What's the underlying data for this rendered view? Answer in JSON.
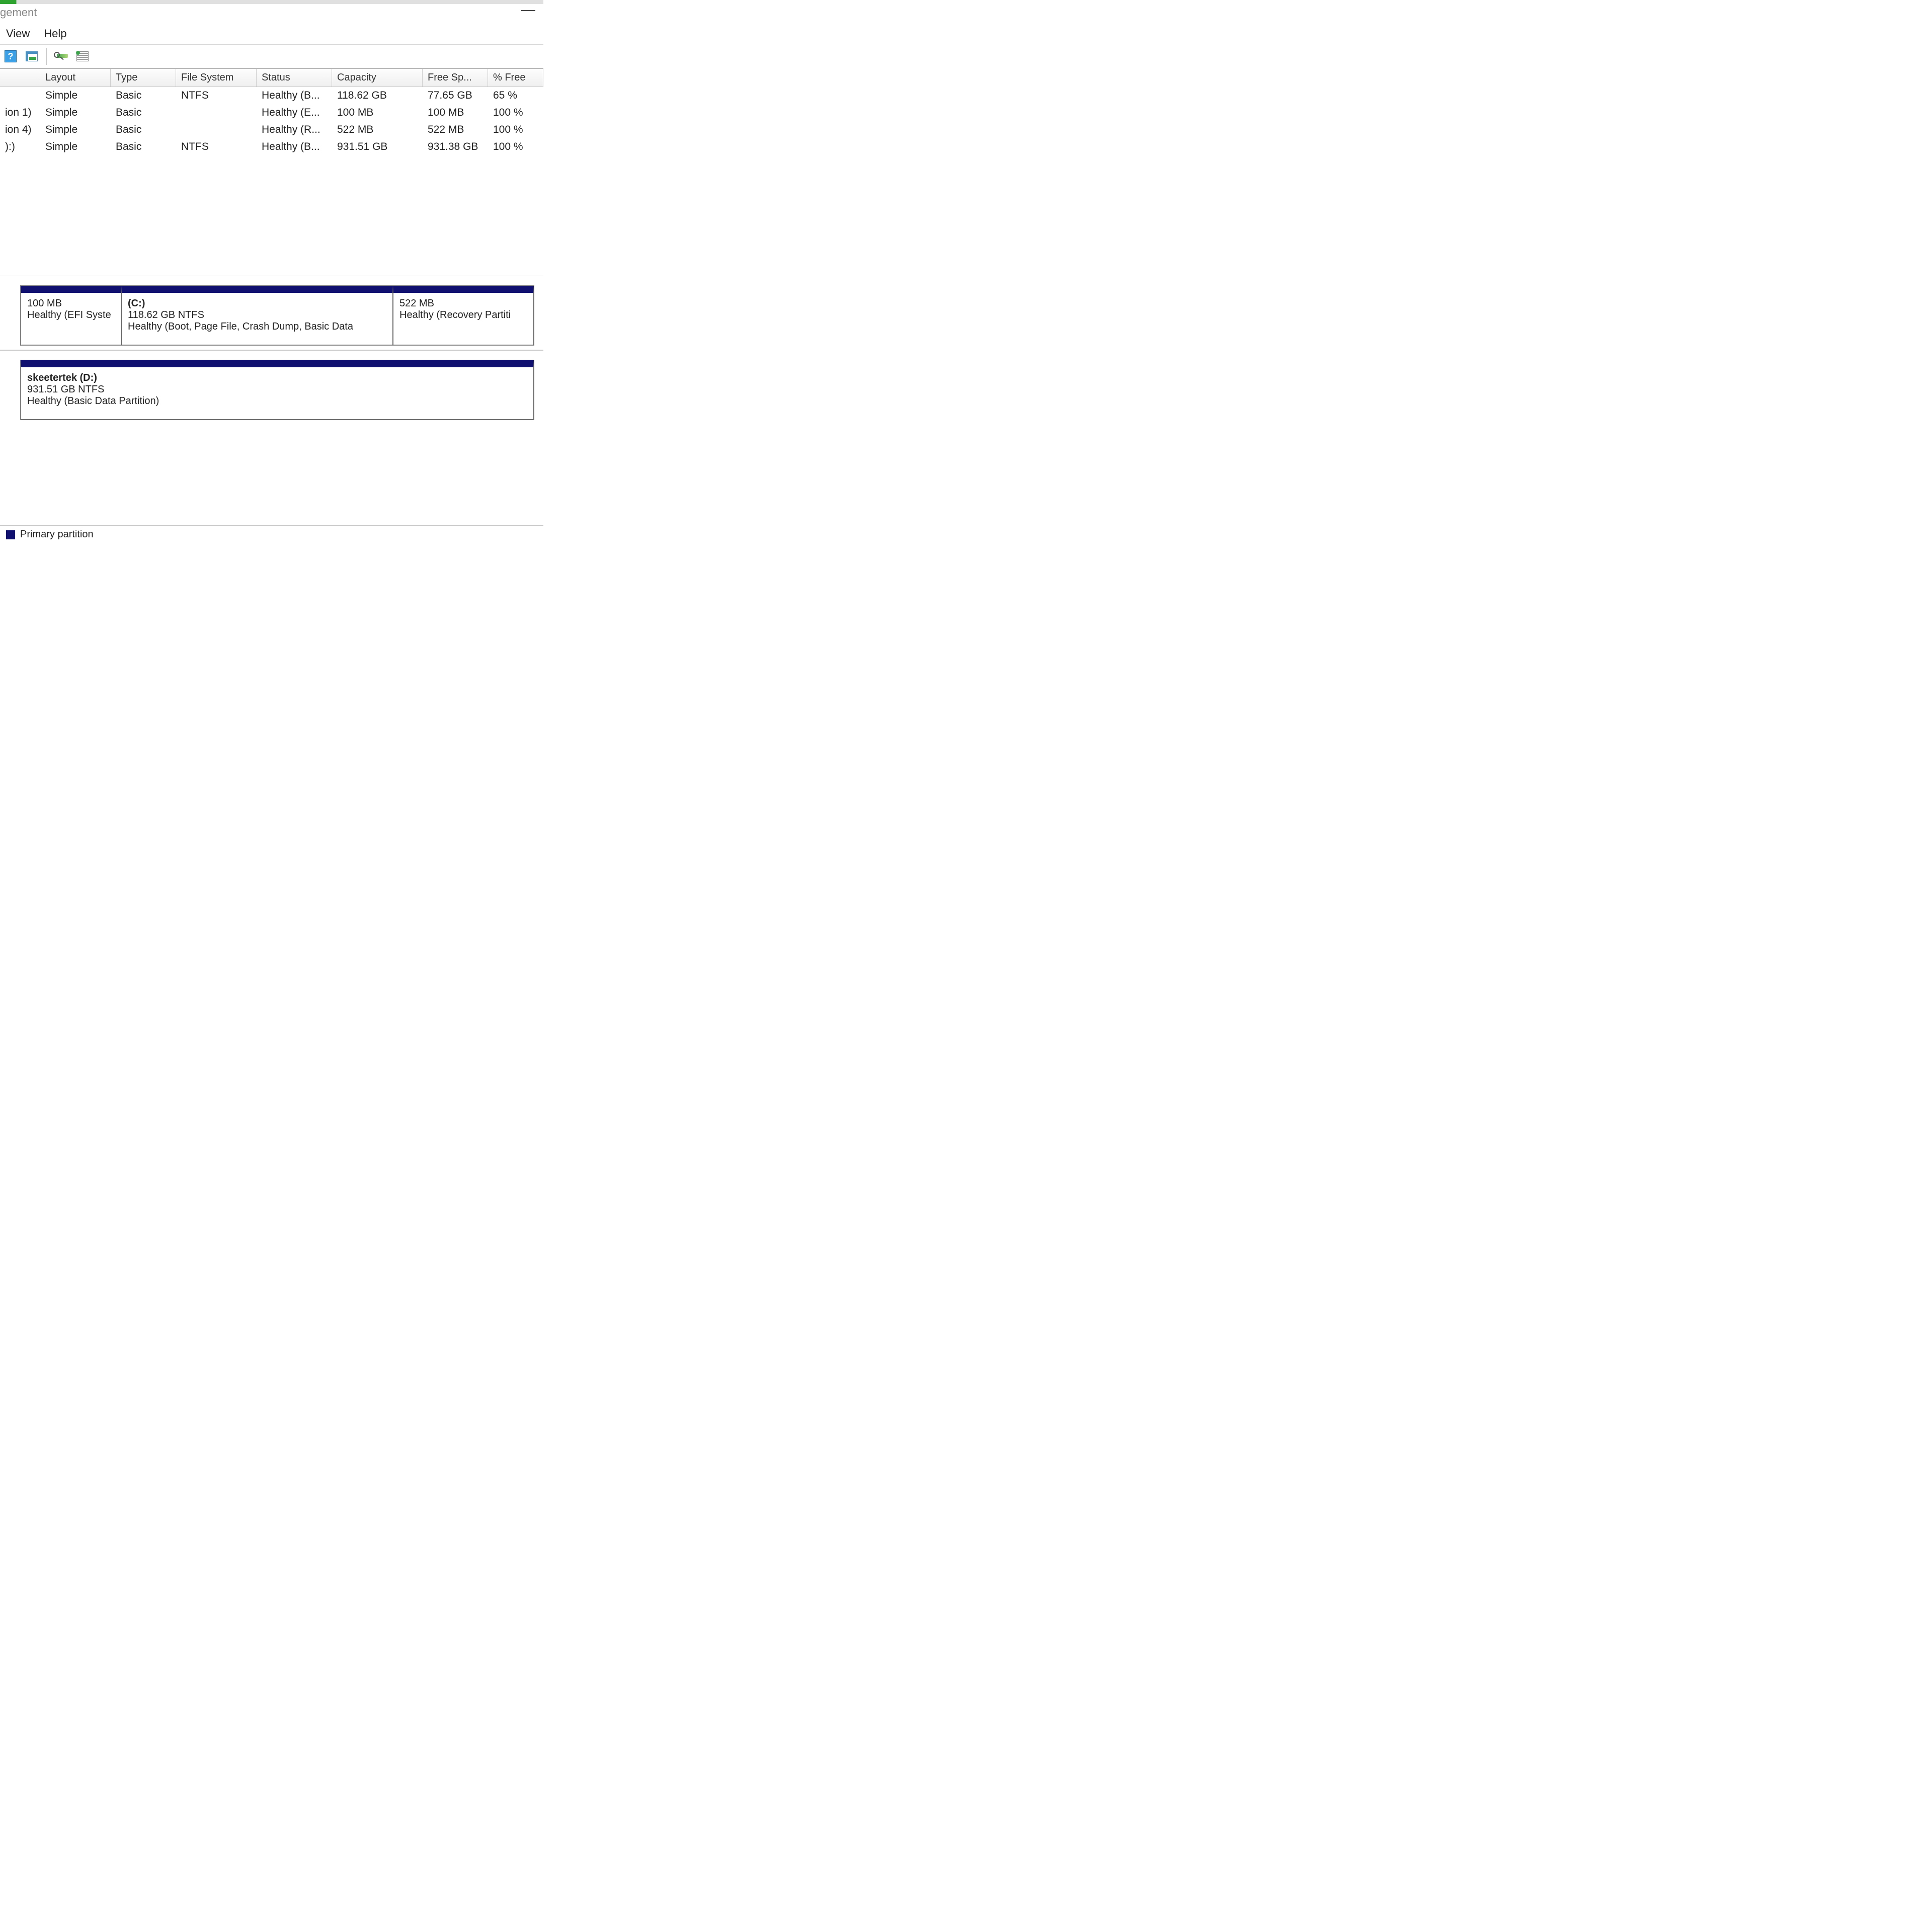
{
  "title_fragment": "gement",
  "menu": {
    "view": "View",
    "help": "Help"
  },
  "columns": {
    "volume": "",
    "layout": "Layout",
    "type": "Type",
    "fs": "File System",
    "status": "Status",
    "capacity": "Capacity",
    "free": "Free Sp...",
    "pct": "% Free"
  },
  "volumes": [
    {
      "name": "",
      "layout": "Simple",
      "type": "Basic",
      "fs": "NTFS",
      "status": "Healthy (B...",
      "capacity": "118.62 GB",
      "free": "77.65 GB",
      "pct": "65 %"
    },
    {
      "name": "ion 1)",
      "layout": "Simple",
      "type": "Basic",
      "fs": "",
      "status": "Healthy (E...",
      "capacity": "100 MB",
      "free": "100 MB",
      "pct": "100 %"
    },
    {
      "name": "ion 4)",
      "layout": "Simple",
      "type": "Basic",
      "fs": "",
      "status": "Healthy (R...",
      "capacity": "522 MB",
      "free": "522 MB",
      "pct": "100 %"
    },
    {
      "name": "):)",
      "layout": "Simple",
      "type": "Basic",
      "fs": "NTFS",
      "status": "Healthy (B...",
      "capacity": "931.51 GB",
      "free": "931.38 GB",
      "pct": "100 %"
    }
  ],
  "vol_name_display": [
    "",
    "ion 1)",
    "ion 4)",
    "):)"
  ],
  "disk0": {
    "p1": {
      "name": "",
      "size": "100 MB",
      "status": "Healthy (EFI Syste"
    },
    "p2": {
      "name": "(C:)",
      "size": "118.62 GB NTFS",
      "status": "Healthy (Boot, Page File, Crash Dump, Basic Data"
    },
    "p3": {
      "name": "",
      "size": "522 MB",
      "status": "Healthy (Recovery Partiti"
    }
  },
  "disk1": {
    "p1": {
      "name": "skeetertek  (D:)",
      "size": "931.51 GB NTFS",
      "status": "Healthy (Basic Data Partition)"
    }
  },
  "legend": {
    "primary": "Primary partition"
  }
}
